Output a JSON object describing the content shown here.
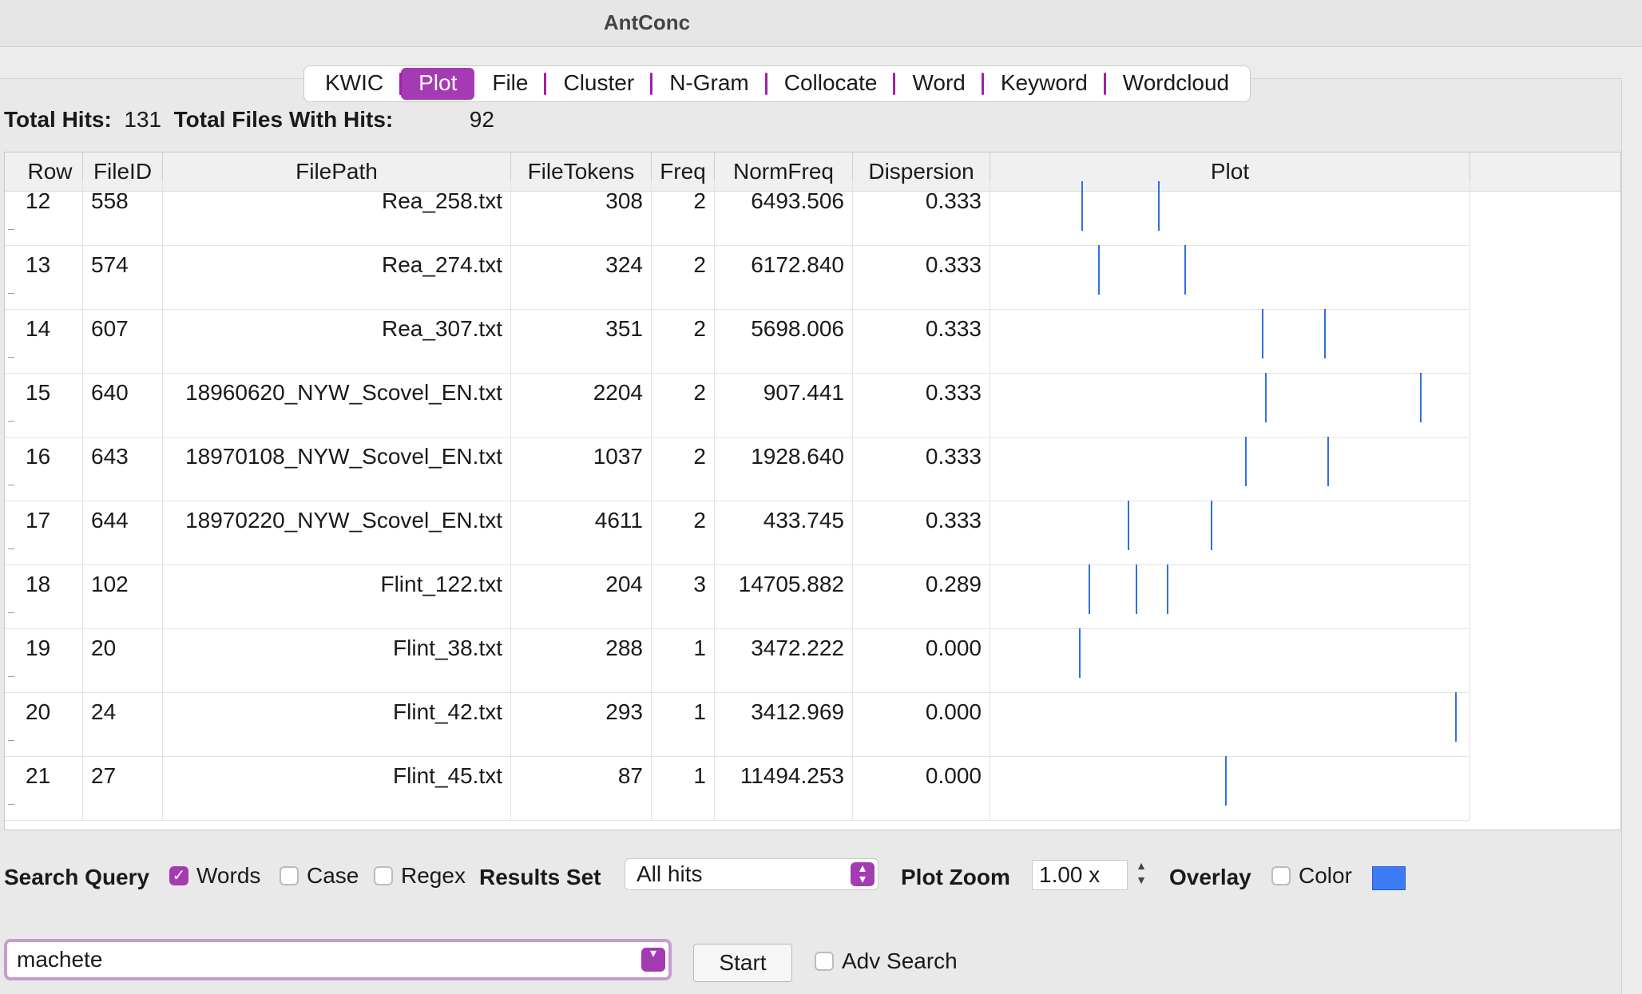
{
  "window": {
    "title": "AntConc"
  },
  "tabs": [
    "KWIC",
    "Plot",
    "File",
    "Cluster",
    "N-Gram",
    "Collocate",
    "Word",
    "Keyword",
    "Wordcloud"
  ],
  "active_tab": "Plot",
  "stats": {
    "total_hits_label": "Total Hits:",
    "total_hits": "131",
    "files_label": "Total Files With Hits:",
    "files": "92"
  },
  "table": {
    "columns": [
      "Row",
      "FileID",
      "FilePath",
      "FileTokens",
      "Freq",
      "NormFreq",
      "Dispersion",
      "Plot"
    ],
    "rows": [
      {
        "row": "12",
        "fileid": "558",
        "path": "Rea_258.txt",
        "tokens": "308",
        "freq": "2",
        "norm": "6493.506",
        "disp": "0.333",
        "hits": [
          0.19,
          0.35
        ]
      },
      {
        "row": "13",
        "fileid": "574",
        "path": "Rea_274.txt",
        "tokens": "324",
        "freq": "2",
        "norm": "6172.840",
        "disp": "0.333",
        "hits": [
          0.225,
          0.405
        ]
      },
      {
        "row": "14",
        "fileid": "607",
        "path": "Rea_307.txt",
        "tokens": "351",
        "freq": "2",
        "norm": "5698.006",
        "disp": "0.333",
        "hits": [
          0.565,
          0.695
        ]
      },
      {
        "row": "15",
        "fileid": "640",
        "path": "18960620_NYW_Scovel_EN.txt",
        "tokens": "2204",
        "freq": "2",
        "norm": "907.441",
        "disp": "0.333",
        "hits": [
          0.573,
          0.896
        ]
      },
      {
        "row": "16",
        "fileid": "643",
        "path": "18970108_NYW_Scovel_EN.txt",
        "tokens": "1037",
        "freq": "2",
        "norm": "1928.640",
        "disp": "0.333",
        "hits": [
          0.53,
          0.702
        ]
      },
      {
        "row": "17",
        "fileid": "644",
        "path": "18970220_NYW_Scovel_EN.txt",
        "tokens": "4611",
        "freq": "2",
        "norm": "433.745",
        "disp": "0.333",
        "hits": [
          0.287,
          0.46
        ]
      },
      {
        "row": "18",
        "fileid": "102",
        "path": "Flint_122.txt",
        "tokens": "204",
        "freq": "3",
        "norm": "14705.882",
        "disp": "0.289",
        "hits": [
          0.205,
          0.302,
          0.367
        ]
      },
      {
        "row": "19",
        "fileid": "20",
        "path": "Flint_38.txt",
        "tokens": "288",
        "freq": "1",
        "norm": "3472.222",
        "disp": "0.000",
        "hits": [
          0.185
        ]
      },
      {
        "row": "20",
        "fileid": "24",
        "path": "Flint_42.txt",
        "tokens": "293",
        "freq": "1",
        "norm": "3412.969",
        "disp": "0.000",
        "hits": [
          0.968
        ]
      },
      {
        "row": "21",
        "fileid": "27",
        "path": "Flint_45.txt",
        "tokens": "87",
        "freq": "1",
        "norm": "11494.253",
        "disp": "0.000",
        "hits": [
          0.49
        ]
      }
    ]
  },
  "controls": {
    "search_query_label": "Search Query",
    "words_label": "Words",
    "case_label": "Case",
    "regex_label": "Regex",
    "results_set_label": "Results Set",
    "results_set_value": "All hits",
    "plot_zoom_label": "Plot Zoom",
    "plot_zoom_value": "1.00 x",
    "overlay_label": "Overlay",
    "color_label": "Color",
    "overlay_color": "#3d7bf5",
    "accent_color": "#a43bb3",
    "query_value": "machete",
    "start_label": "Start",
    "adv_search_label": "Adv Search"
  }
}
